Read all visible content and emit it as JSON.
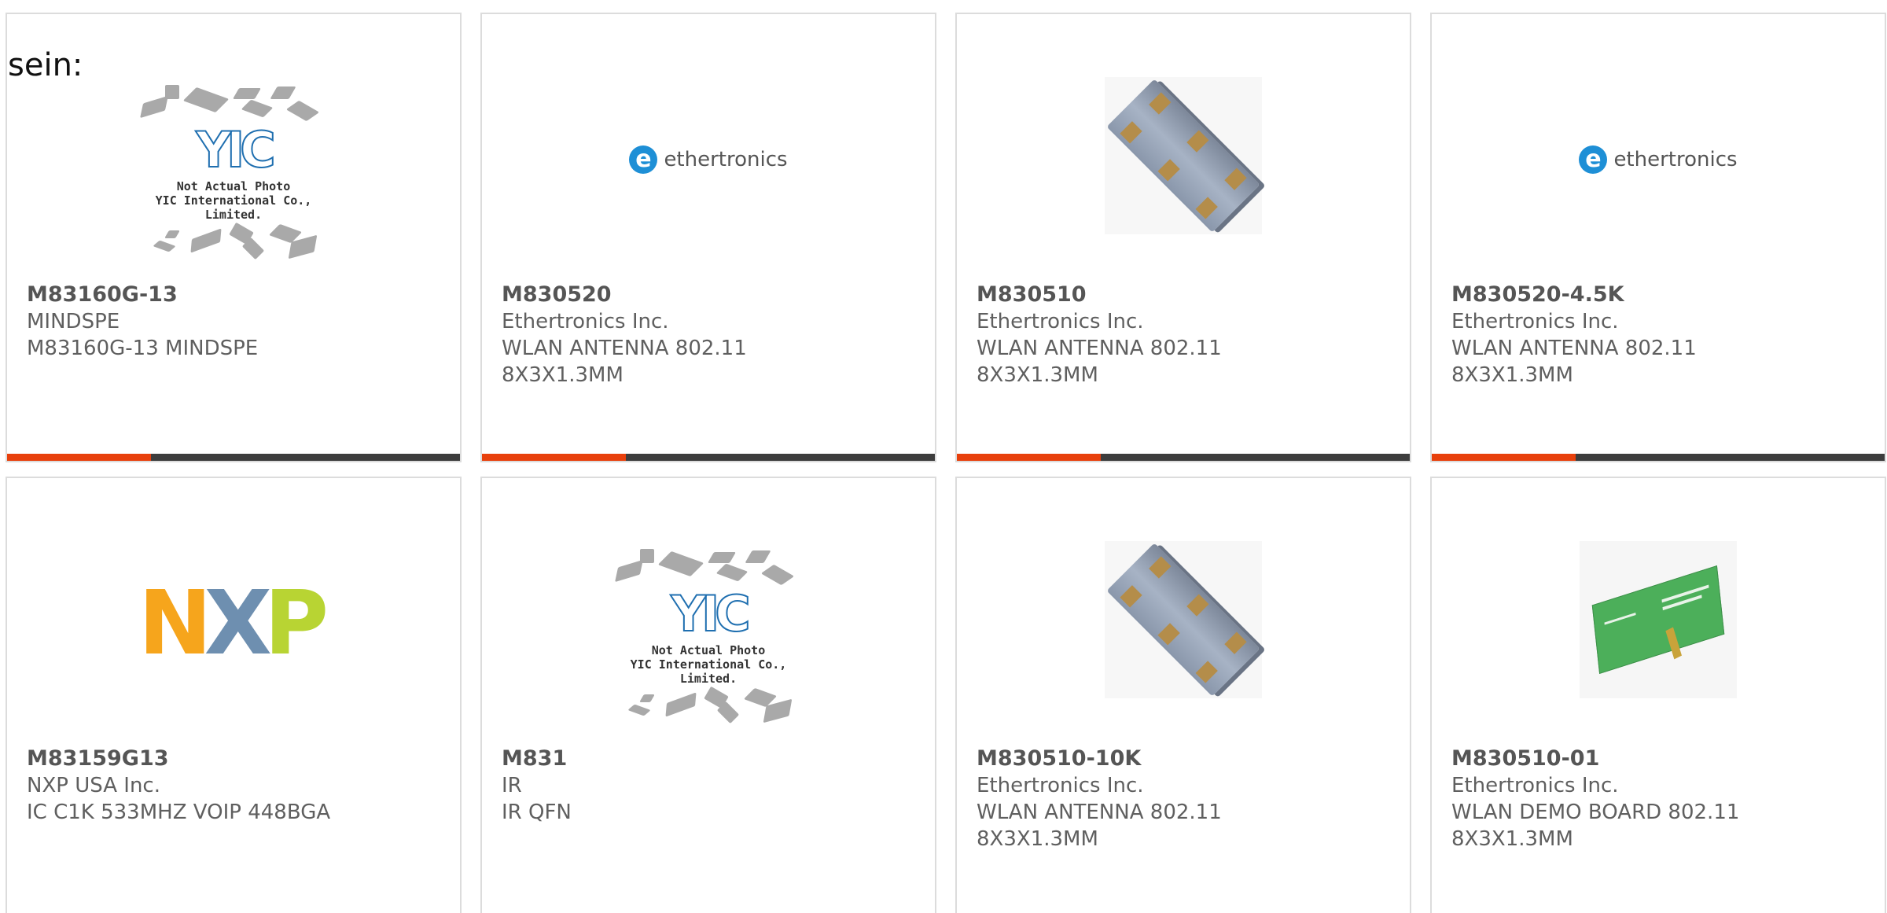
{
  "intro_text": "sein:",
  "image_labels": {
    "yic_logo": "YIC",
    "yic_caption_1": "Not Actual Photo",
    "yic_caption_2": "YIC International Co., Limited.",
    "ethertronics_logo": "ethertronics",
    "nxp_logo": [
      "N",
      "X",
      "P"
    ]
  },
  "colors": {
    "accent_bar": "#e8400c",
    "base_bar": "#3d3d3d",
    "nxp_n": "#f6a51c",
    "nxp_x": "#6e8fb0",
    "nxp_p": "#b8d433"
  },
  "products": [
    {
      "part_number": "M83160G-13",
      "manufacturer": "MINDSPE",
      "description_lines": [
        "M83160G-13 MINDSPE"
      ],
      "image": "yic-placeholder"
    },
    {
      "part_number": "M830520",
      "manufacturer": "Ethertronics Inc.",
      "description_lines": [
        "WLAN ANTENNA 802.11",
        "8X3X1.3MM"
      ],
      "image": "ethertronics-logo"
    },
    {
      "part_number": "M830510",
      "manufacturer": "Ethertronics Inc.",
      "description_lines": [
        "WLAN ANTENNA 802.11",
        "8X3X1.3MM"
      ],
      "image": "antenna-chip"
    },
    {
      "part_number": "M830520-4.5K",
      "manufacturer": "Ethertronics Inc.",
      "description_lines": [
        "WLAN ANTENNA 802.11",
        "8X3X1.3MM"
      ],
      "image": "ethertronics-logo"
    },
    {
      "part_number": "M83159G13",
      "manufacturer": "NXP USA Inc.",
      "description_lines": [
        "IC C1K 533MHZ VOIP 448BGA"
      ],
      "image": "nxp-logo"
    },
    {
      "part_number": "M831",
      "manufacturer": "IR",
      "description_lines": [
        "IR QFN"
      ],
      "image": "yic-placeholder"
    },
    {
      "part_number": "M830510-10K",
      "manufacturer": "Ethertronics Inc.",
      "description_lines": [
        "WLAN ANTENNA 802.11",
        "8X3X1.3MM"
      ],
      "image": "antenna-chip"
    },
    {
      "part_number": "M830510-01",
      "manufacturer": "Ethertronics Inc.",
      "description_lines": [
        "WLAN DEMO BOARD 802.11",
        "8X3X1.3MM"
      ],
      "image": "demo-board"
    }
  ]
}
